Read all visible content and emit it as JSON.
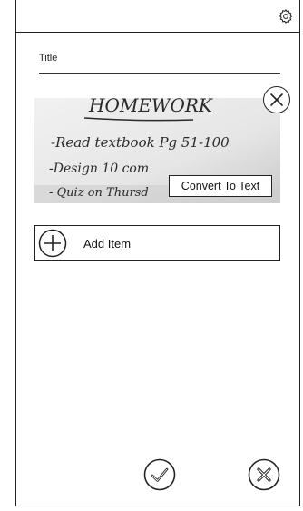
{
  "form": {
    "title_label": "Title"
  },
  "photo": {
    "handwriting": {
      "heading": "HOMEWORK",
      "line1": "-Read textbook Pg 51-100",
      "line2": "-Design 10 com",
      "line3": "- Quiz on Thursd"
    },
    "convert_label": "Convert To Text"
  },
  "add_item": {
    "label": "Add Item"
  },
  "icons": {
    "settings": "gear-icon",
    "close": "close-icon",
    "add": "plus-icon",
    "confirm": "check-icon",
    "cancel": "x-icon"
  },
  "colors": {
    "stroke": "#222222",
    "background": "#ffffff"
  }
}
